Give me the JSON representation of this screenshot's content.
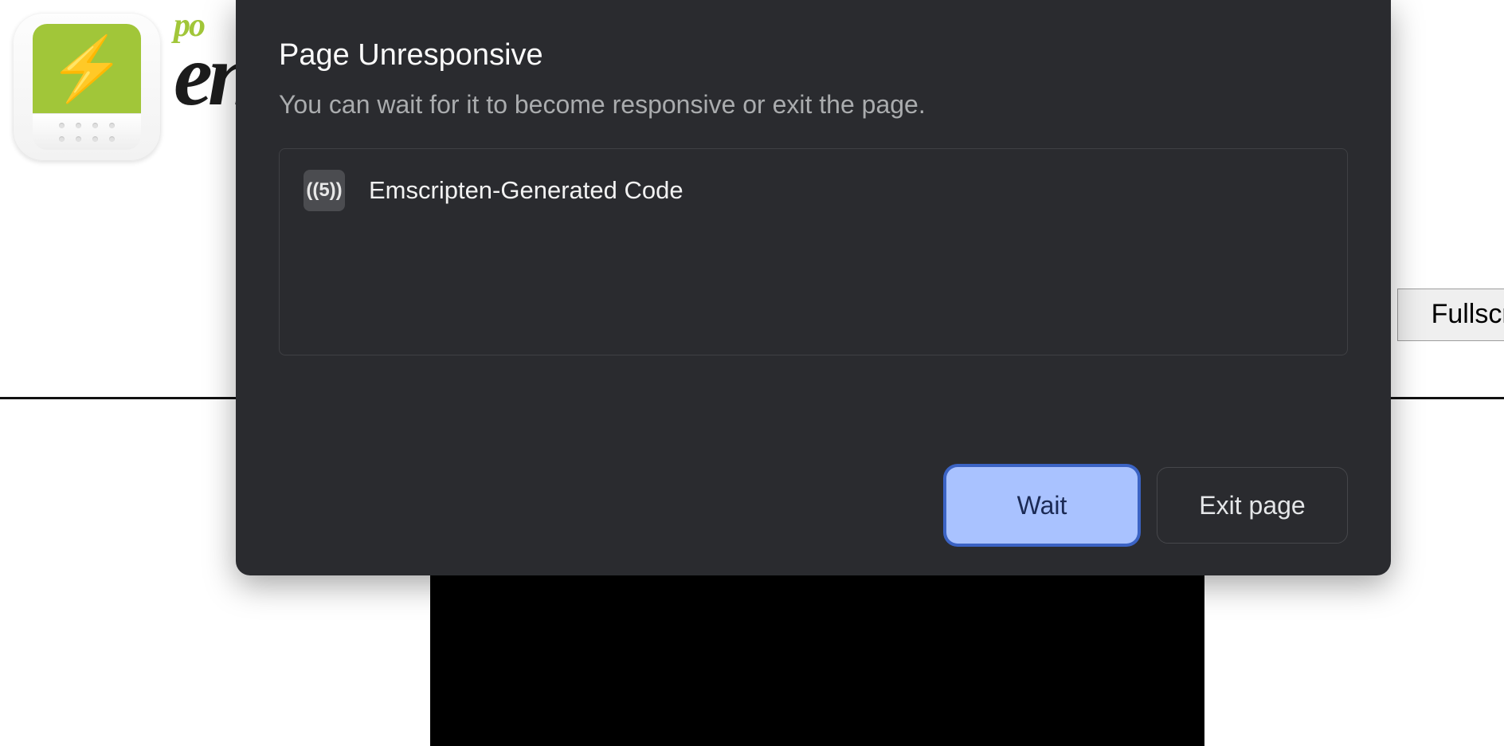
{
  "brand": {
    "tagline_fragment": "po",
    "name_fragment": "en"
  },
  "toolbar": {
    "fullscreen_label": "Fullscreen"
  },
  "dialog": {
    "title": "Page Unresponsive",
    "message": "You can wait for it to become responsive or exit the page.",
    "pages": [
      {
        "favicon_label": "((5))",
        "title": "Emscripten-Generated Code"
      }
    ],
    "buttons": {
      "wait_label": "Wait",
      "exit_label": "Exit page"
    }
  }
}
